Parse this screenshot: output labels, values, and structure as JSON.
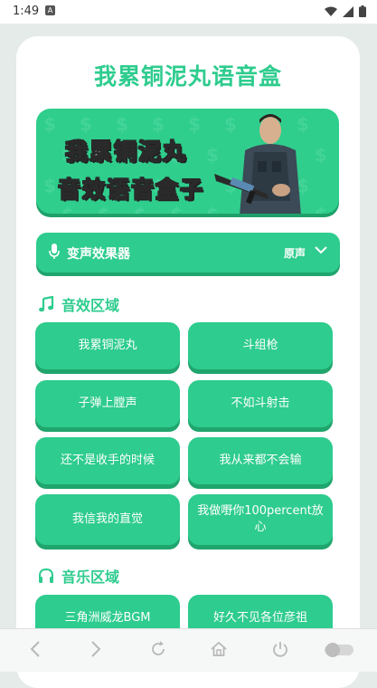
{
  "status": {
    "time": "1:49"
  },
  "app": {
    "title": "我累铜泥丸语音盒",
    "banner": {
      "line1": "我累铜泥丸",
      "line2": "音效语音盒子"
    },
    "voice_changer": {
      "label": "变声效果器",
      "value": "原声"
    }
  },
  "sound_section": {
    "title": "音效区域",
    "buttons": [
      "我累铜泥丸",
      "斗组枪",
      "子弹上膛声",
      "不如斗射击",
      "还不是收手的时候",
      "我从来都不会输",
      "我信我的直觉",
      "我做嘢你100percent放心"
    ]
  },
  "music_section": {
    "title": "音乐区域",
    "buttons": [
      "三角洲威龙BGM",
      "好久不见各位彦祖"
    ]
  },
  "colors": {
    "accent": "#2ecc8e",
    "accent_shadow": "#1fa56d",
    "background": "#e4ebe8"
  },
  "icons": {
    "status": [
      "a-notification-icon",
      "wifi-icon",
      "signal-icon",
      "battery-icon"
    ],
    "browser": [
      "back-icon",
      "forward-icon",
      "refresh-icon",
      "home-icon",
      "power-icon",
      "toggle-icon"
    ]
  }
}
